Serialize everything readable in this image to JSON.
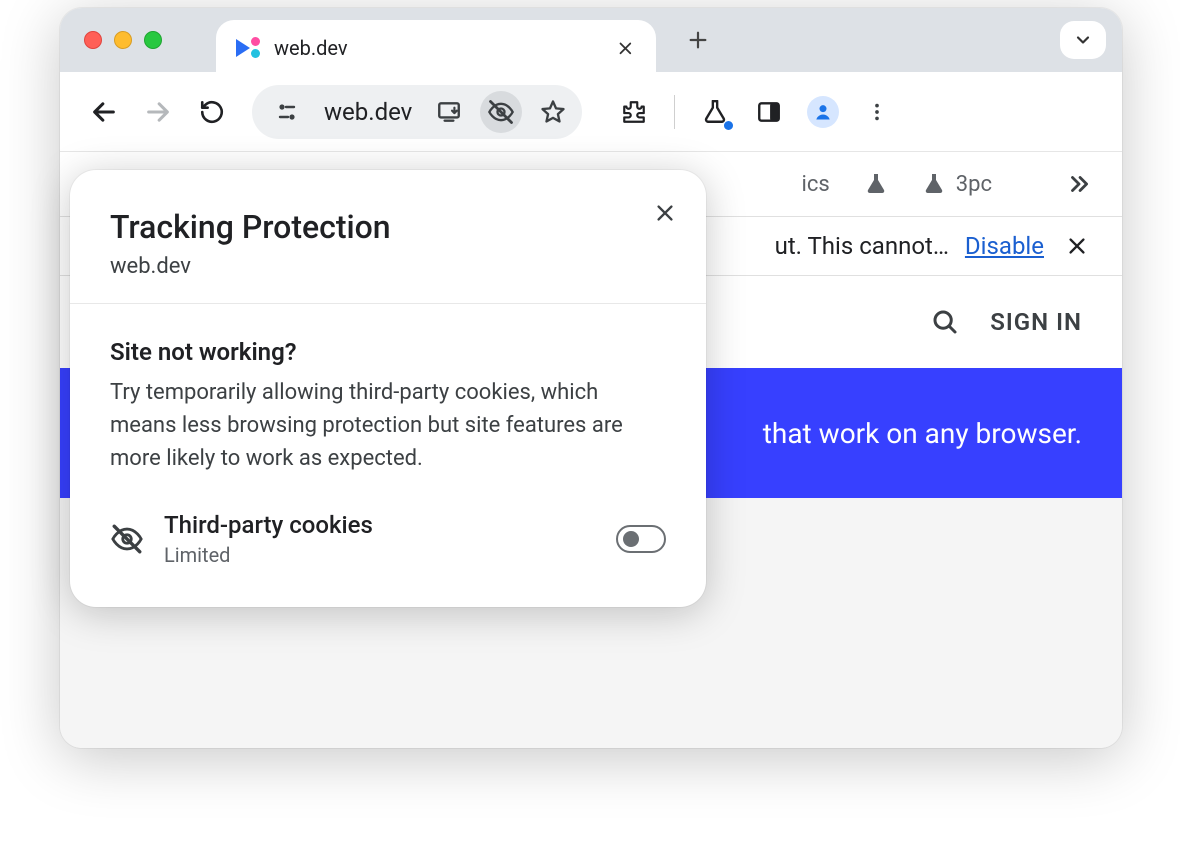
{
  "tab": {
    "title": "web.dev"
  },
  "omnibox": {
    "address": "web.dev"
  },
  "bookmarks": {
    "item1_partial": "ics",
    "item2": "3pc"
  },
  "infobar": {
    "text_fragment": "ut. This cannot…",
    "action": "Disable"
  },
  "page": {
    "signin": "SIGN IN",
    "hero_fragment": "that work on any browser."
  },
  "popover": {
    "title": "Tracking Protection",
    "site": "web.dev",
    "q": "Site not working?",
    "desc": "Try temporarily allowing third-party cookies, which means less browsing protection but site features are more likely to work as expected.",
    "row_title": "Third-party cookies",
    "row_status": "Limited"
  }
}
